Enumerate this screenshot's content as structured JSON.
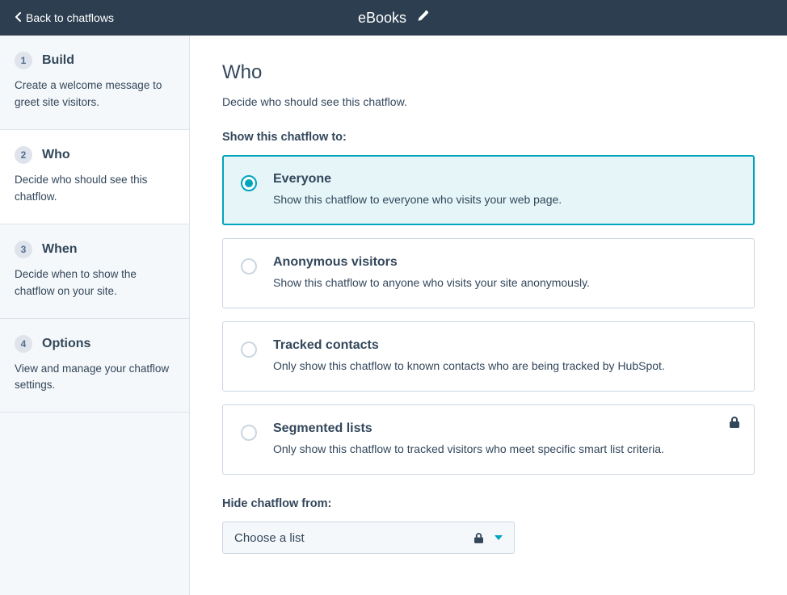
{
  "topbar": {
    "back_label": "Back to chatflows",
    "title": "eBooks"
  },
  "sidebar": {
    "steps": [
      {
        "num": "1",
        "title": "Build",
        "desc": "Create a welcome message to greet site visitors."
      },
      {
        "num": "2",
        "title": "Who",
        "desc": "Decide who should see this chatflow."
      },
      {
        "num": "3",
        "title": "When",
        "desc": "Decide when to show the chatflow on your site."
      },
      {
        "num": "4",
        "title": "Options",
        "desc": "View and manage your chatflow settings."
      }
    ]
  },
  "main": {
    "title": "Who",
    "subtitle": "Decide who should see this chatflow.",
    "show_label": "Show this chatflow to:",
    "options": [
      {
        "title": "Everyone",
        "desc": "Show this chatflow to everyone who visits your web page.",
        "locked": false,
        "selected": true
      },
      {
        "title": "Anonymous visitors",
        "desc": "Show this chatflow to anyone who visits your site anonymously.",
        "locked": false,
        "selected": false
      },
      {
        "title": "Tracked contacts",
        "desc": "Only show this chatflow to known contacts who are being tracked by HubSpot.",
        "locked": false,
        "selected": false
      },
      {
        "title": "Segmented lists",
        "desc": "Only show this chatflow to tracked visitors who meet specific smart list criteria.",
        "locked": true,
        "selected": false
      }
    ],
    "hide_label": "Hide chatflow from:",
    "hide_select_placeholder": "Choose a list"
  }
}
